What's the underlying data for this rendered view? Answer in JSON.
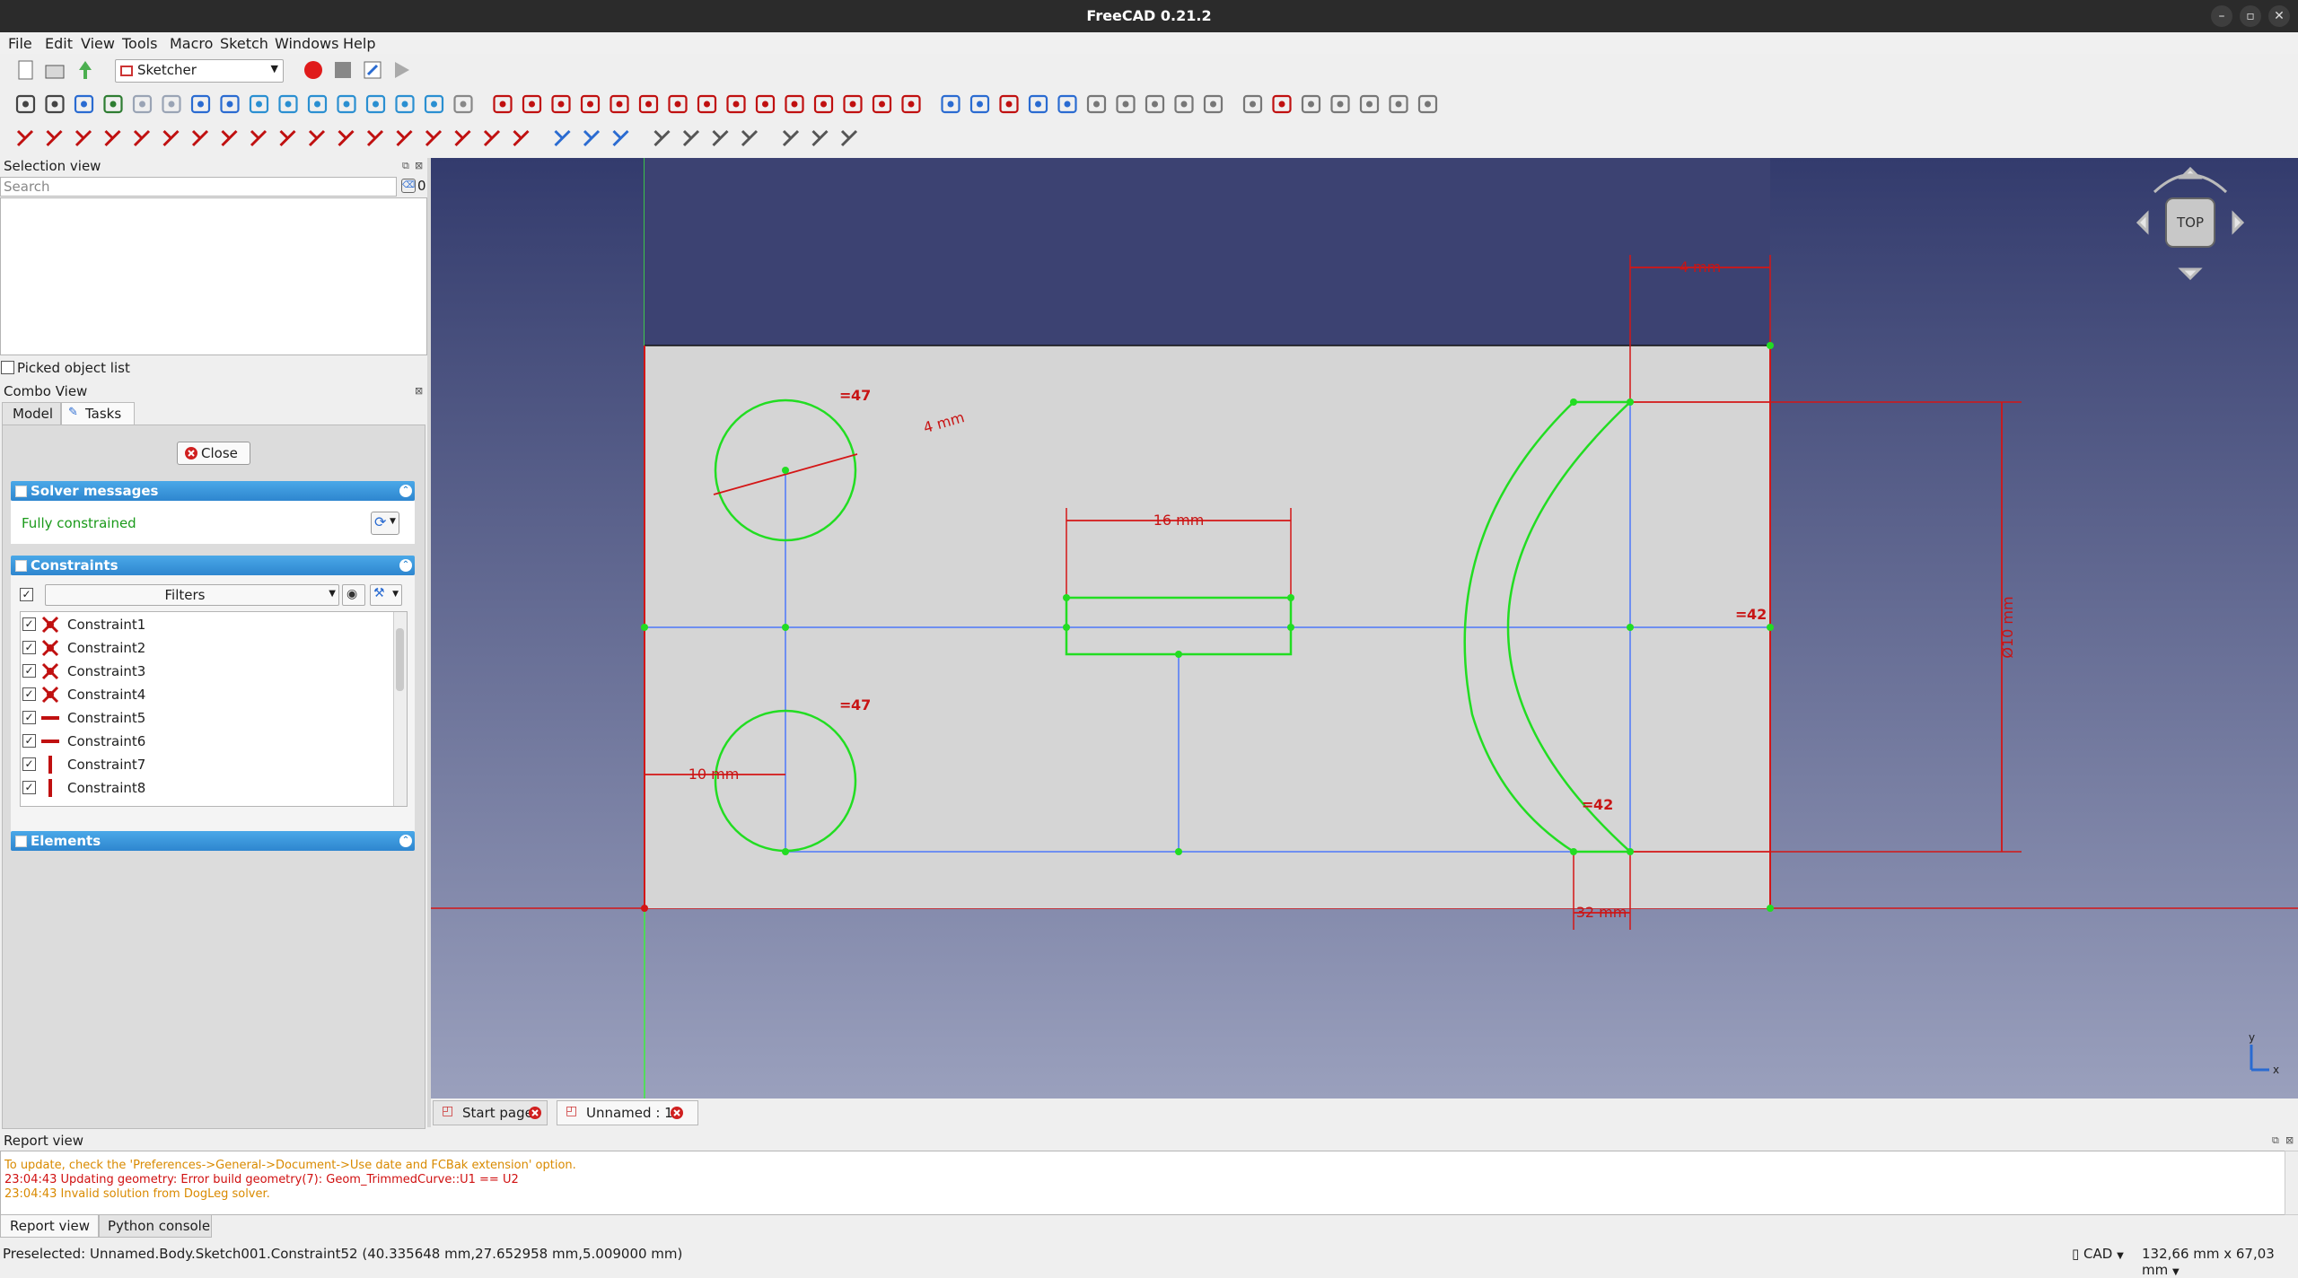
{
  "window": {
    "title": "FreeCAD 0.21.2"
  },
  "menu": [
    "File",
    "Edit",
    "View",
    "Tools",
    "Macro",
    "Sketch",
    "Windows",
    "Help"
  ],
  "workbench": {
    "selected": "Sketcher"
  },
  "selection_view": {
    "title": "Selection view",
    "search_placeholder": "Search",
    "count": "0",
    "picked_label": "Picked object list"
  },
  "combo_view": {
    "title": "Combo View",
    "tabs": [
      "Model",
      "Tasks"
    ],
    "close_label": "Close",
    "solver": {
      "header": "Solver messages",
      "status": "Fully constrained",
      "status_color": "#1a9a1a"
    },
    "constraints": {
      "header": "Constraints",
      "filters_label": "Filters",
      "items": [
        {
          "name": "Constraint1",
          "icon": "coincident-icon"
        },
        {
          "name": "Constraint2",
          "icon": "coincident-icon"
        },
        {
          "name": "Constraint3",
          "icon": "coincident-icon"
        },
        {
          "name": "Constraint4",
          "icon": "coincident-icon"
        },
        {
          "name": "Constraint5",
          "icon": "horizontal-icon"
        },
        {
          "name": "Constraint6",
          "icon": "horizontal-icon"
        },
        {
          "name": "Constraint7",
          "icon": "vertical-icon"
        },
        {
          "name": "Constraint8",
          "icon": "vertical-icon"
        }
      ]
    },
    "elements": {
      "header": "Elements"
    }
  },
  "viewport": {
    "navcube_face": "TOP",
    "dimensions": [
      "10 mm",
      "4 mm",
      "32 mm",
      "Ø10 mm",
      "16 mm",
      "4 mm"
    ],
    "equal_labels": [
      "47",
      "47",
      "42",
      "42"
    ],
    "tabs": [
      {
        "label": "Start page"
      },
      {
        "label": "Unnamed : 1*"
      }
    ],
    "axis_labels": {
      "y": "y",
      "x": "x"
    }
  },
  "report_view": {
    "title": "Report view",
    "lines": [
      {
        "text": "To update, check the 'Preferences->General->Document->Use date and FCBak extension' option.",
        "color": "#d98a00"
      },
      {
        "text": "23:04:43  Updating geometry: Error build geometry(7): Geom_TrimmedCurve::U1 == U2",
        "color": "#d01010"
      },
      {
        "text": "23:04:43  Invalid solution from DogLeg solver.",
        "color": "#d98a00"
      }
    ],
    "tabs": [
      "Report view",
      "Python console"
    ]
  },
  "status_bar": {
    "preselected": "Preselected: Unnamed.Body.Sketch001.Constraint52 (40.335648 mm,27.652958 mm,5.009000 mm)",
    "nav_style": "CAD",
    "dimensions": "132,66 mm x 67,03 mm"
  }
}
